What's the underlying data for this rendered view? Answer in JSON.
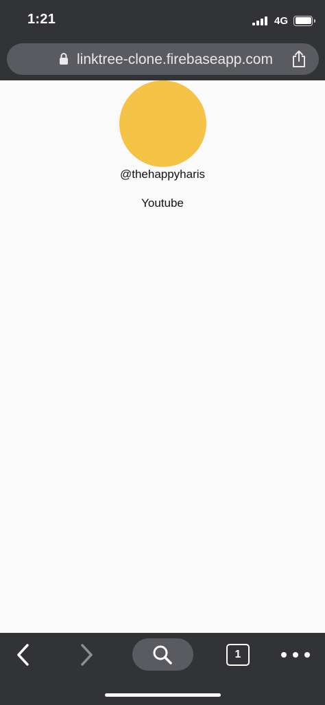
{
  "status_bar": {
    "time": "1:21",
    "network": "4G",
    "icons": [
      "signal-bars-icon",
      "battery-icon"
    ]
  },
  "browser": {
    "url": "linktree-clone.firebaseapp.com",
    "icons": [
      "lock-icon",
      "share-icon"
    ]
  },
  "profile": {
    "username": "@thehappyharis",
    "avatar_color": "#f4c345"
  },
  "links": [
    {
      "label": "Youtube"
    }
  ],
  "toolbar": {
    "tab_count": "1",
    "icons": [
      "back-arrow-icon",
      "forward-arrow-icon",
      "search-icon",
      "tabs-icon",
      "more-dots-icon"
    ]
  },
  "colors": {
    "chrome_background": "#323337",
    "pill_background": "#5a5b60",
    "page_background": "#fafafa"
  }
}
